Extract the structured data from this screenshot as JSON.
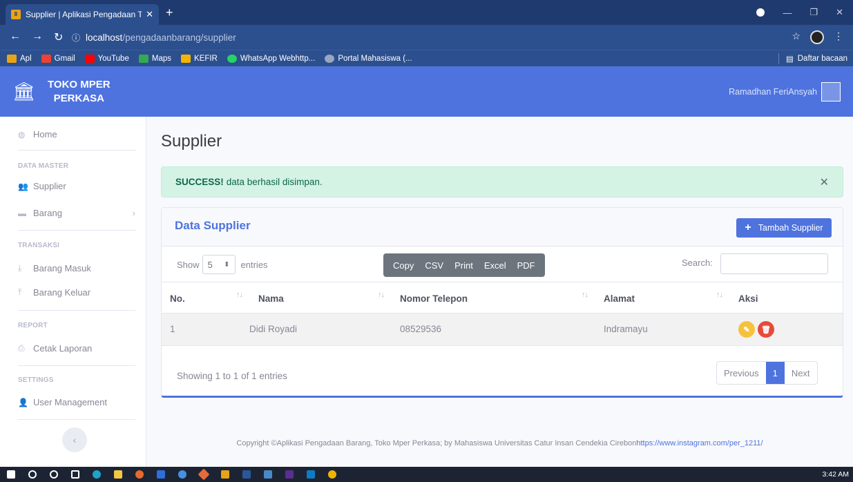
{
  "browser": {
    "tab_title": "Supplier | Aplikasi Pengadaan Tra",
    "tab_close": "✕",
    "new_tab": "+",
    "url_host": "localhost",
    "url_path": "/pengadaanbarang/supplier",
    "bookmarks": [
      {
        "label": "Apl",
        "color": "#e8a317"
      },
      {
        "label": "Gmail",
        "color": "#ea4335"
      },
      {
        "label": "YouTube",
        "color": "#ff0000"
      },
      {
        "label": "Maps",
        "color": "#34a853"
      },
      {
        "label": "KEFIR",
        "color": "#f4b400"
      },
      {
        "label": "WhatsApp Webhttp...",
        "color": "#25d366"
      },
      {
        "label": "Portal Mahasiswa (...",
        "color": "#9aa6bf"
      }
    ],
    "reading_list": "Daftar bacaan"
  },
  "app": {
    "brand_line1": "TOKO MPER",
    "brand_line2": "PERKASA",
    "user_name": "Ramadhan FeriAnsyah"
  },
  "sidebar": {
    "home": "Home",
    "section_master": "DATA MASTER",
    "supplier": "Supplier",
    "barang": "Barang",
    "section_transaksi": "TRANSAKSI",
    "barang_masuk": "Barang Masuk",
    "barang_keluar": "Barang Keluar",
    "section_report": "REPORT",
    "cetak_laporan": "Cetak Laporan",
    "section_settings": "SETTINGS",
    "user_management": "User Management"
  },
  "page": {
    "title": "Supplier",
    "alert_strong": "SUCCESS!",
    "alert_text": "data berhasil disimpan.",
    "card_title": "Data Supplier",
    "add_button": "Tambah Supplier",
    "show_label": "Show",
    "entries_value": "5",
    "entries_label": "entries",
    "export_buttons": [
      "Copy",
      "CSV",
      "Print",
      "Excel",
      "PDF"
    ],
    "search_label": "Search:",
    "columns": [
      "No.",
      "Nama",
      "Nomor Telepon",
      "Alamat",
      "Aksi"
    ],
    "rows": [
      {
        "no": "1",
        "nama": "Didi Royadi",
        "telepon": "08529536",
        "alamat": "Indramayu"
      }
    ],
    "info": "Showing 1 to 1 of 1 entries",
    "pager_prev": "Previous",
    "pager_current": "1",
    "pager_next": "Next"
  },
  "footer": {
    "text": "Copyright ©Aplikasi Pengadaan Barang, Toko Mper Perkasa; by Mahasiswa Universitas Catur Insan Cendekia Cirebon",
    "link": "https://www.instagram.com/per_1211/"
  },
  "taskbar": {
    "clock": "3:42 AM"
  },
  "colors": {
    "primary": "#4e73df",
    "success_bg": "#d4f3e5",
    "edit_button": "#f6c23e",
    "delete_button": "#e74a3b"
  }
}
